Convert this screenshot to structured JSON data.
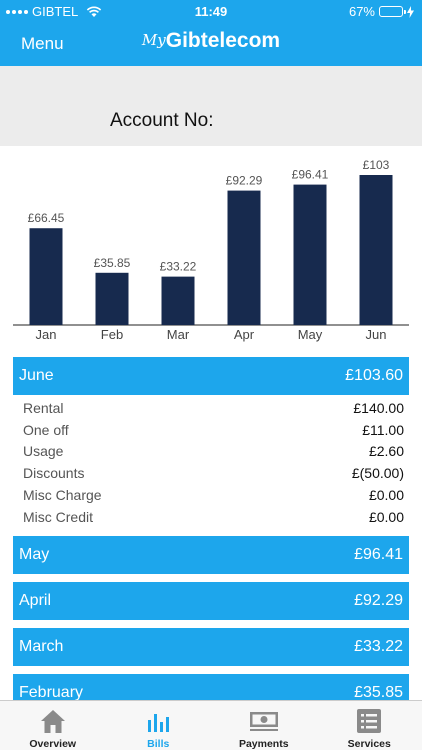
{
  "status_bar": {
    "carrier": "GIBTEL",
    "time": "11:49",
    "battery": "67%",
    "battery_level": 0.67
  },
  "nav": {
    "menu_label": "Menu",
    "logo_prefix": "My",
    "logo_brand": "Gibtelecom"
  },
  "account": {
    "label": "Account No:"
  },
  "colors": {
    "brand": "#1da6ec",
    "bar": "#172a4e",
    "battery_fill": "#4cd964"
  },
  "chart_data": {
    "type": "bar",
    "categories": [
      "Jan",
      "Feb",
      "Mar",
      "Apr",
      "May",
      "Jun"
    ],
    "values": [
      66.45,
      35.85,
      33.22,
      92.29,
      96.41,
      103
    ],
    "value_labels": [
      "£66.45",
      "£35.85",
      "£33.22",
      "£92.29",
      "£96.41",
      "£103"
    ],
    "ylim": [
      0,
      103
    ]
  },
  "bills": {
    "current": {
      "month": "June",
      "total": "£103.60",
      "items": [
        {
          "label": "Rental",
          "value": "£140.00"
        },
        {
          "label": "One off",
          "value": "£11.00"
        },
        {
          "label": "Usage",
          "value": "£2.60"
        },
        {
          "label": "Discounts",
          "value": "£(50.00)"
        },
        {
          "label": "Misc Charge",
          "value": "£0.00"
        },
        {
          "label": "Misc Credit",
          "value": "£0.00"
        }
      ]
    },
    "others": [
      {
        "month": "May",
        "total": "£96.41"
      },
      {
        "month": "April",
        "total": "£92.29"
      },
      {
        "month": "March",
        "total": "£33.22"
      },
      {
        "month": "February",
        "total": "£35.85"
      }
    ]
  },
  "tabs": [
    {
      "label": "Overview",
      "icon": "home-icon"
    },
    {
      "label": "Bills",
      "icon": "bar-chart-icon"
    },
    {
      "label": "Payments",
      "icon": "cash-icon"
    },
    {
      "label": "Services",
      "icon": "list-icon"
    }
  ]
}
